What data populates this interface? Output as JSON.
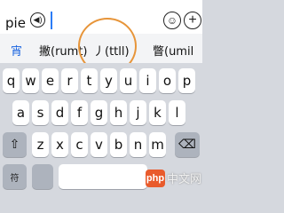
{
  "input": {
    "text": "pie",
    "voice_icon_glyph": "◀)",
    "emoji_icon_glyph": "☺",
    "plus_icon_glyph": "+"
  },
  "candidates": [
    {
      "text": "宵"
    },
    {
      "text": "撇(rumt)"
    },
    {
      "text": "丿(ttll)"
    },
    {
      "text": "瞥(umil"
    }
  ],
  "annotation": {
    "color": "#e7953a"
  },
  "keyboard": {
    "row1": [
      "q",
      "w",
      "e",
      "r",
      "t",
      "y",
      "u",
      "i",
      "o",
      "p"
    ],
    "row2": [
      "a",
      "s",
      "d",
      "f",
      "g",
      "h",
      "j",
      "k",
      "l"
    ],
    "row3": [
      "z",
      "x",
      "c",
      "v",
      "b",
      "n",
      "m"
    ],
    "shift_glyph": "⇧",
    "delete_glyph": "⌫",
    "symbol_label": "符"
  },
  "watermark": {
    "logo": "php",
    "text": "中文网"
  }
}
